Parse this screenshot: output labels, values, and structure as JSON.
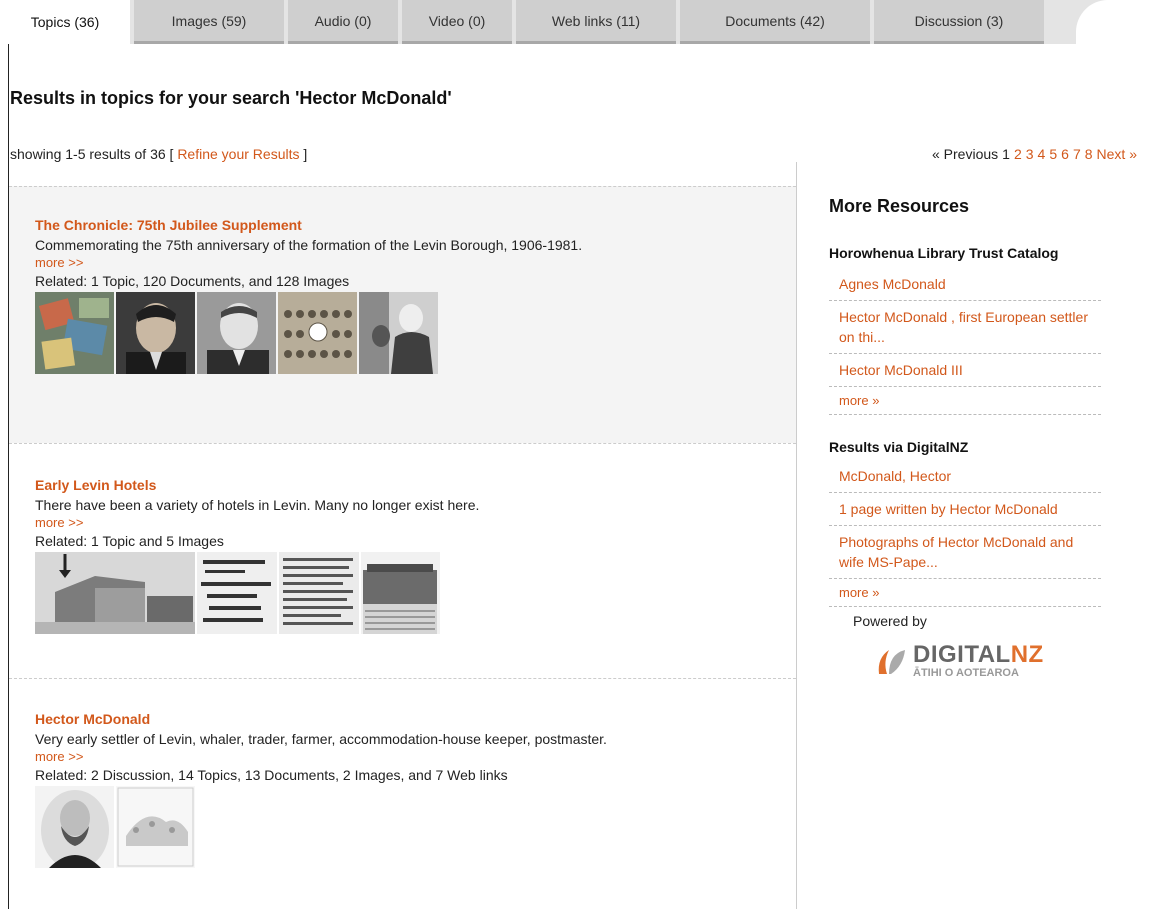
{
  "tabs": [
    {
      "label": "Topics (36)",
      "active": true
    },
    {
      "label": "Images (59)",
      "active": false
    },
    {
      "label": "Audio (0)",
      "active": false
    },
    {
      "label": "Video (0)",
      "active": false
    },
    {
      "label": "Web links (11)",
      "active": false
    },
    {
      "label": "Documents (42)",
      "active": false
    },
    {
      "label": "Discussion (3)",
      "active": false
    }
  ],
  "heading": "Results in topics for your search 'Hector McDonald'",
  "summary": {
    "prefix": "showing 1-5 results of 36 [",
    "refine_link": "Refine your Results",
    "suffix": "]"
  },
  "pagination": {
    "previous": "« Previous",
    "current": "1",
    "pages": [
      "2",
      "3",
      "4",
      "5",
      "6",
      "7",
      "8"
    ],
    "next": "Next »"
  },
  "results": [
    {
      "title": "The Chronicle: 75th Jubilee Supplement",
      "description": "Commemorating the 75th anniversary of the formation of the Levin Borough, 1906-1981.",
      "more": "more >>",
      "related": "Related: 1 Topic, 120 Documents, and 128 Images"
    },
    {
      "title": "Early Levin Hotels",
      "description": "There have been a variety of hotels in Levin. Many no longer exist here.",
      "more": "more >>",
      "related": "Related: 1 Topic and 5 Images"
    },
    {
      "title": "Hector McDonald",
      "description": "Very early settler of Levin, whaler, trader, farmer, accommodation-house keeper, postmaster.",
      "more": "more >>",
      "related": "Related: 2 Discussion, 14 Topics, 13 Documents, 2 Images, and 7 Web links"
    }
  ],
  "sidebar": {
    "title": "More Resources",
    "catalog_title": "Horowhenua Library Trust Catalog",
    "catalog_items": [
      "Agnes McDonald",
      "Hector McDonald , first European settler on thi...",
      "Hector McDonald III"
    ],
    "catalog_more": "more »",
    "digitalnz_title": "Results via DigitalNZ",
    "digitalnz_items": [
      "McDonald, Hector",
      "1 page written by Hector McDonald",
      "Photographs of Hector McDonald and wife MS-Pape..."
    ],
    "digitalnz_more": "more »",
    "powered_by": "Powered by",
    "logo_text_main": "DIGITAL",
    "logo_text_nz": "NZ",
    "logo_tagline": "ĀTIHI O AOTEAROA"
  },
  "colors": {
    "link": "#d2581b",
    "tab_inactive": "#cfcfcf",
    "result_shade": "#f4f4f4"
  }
}
